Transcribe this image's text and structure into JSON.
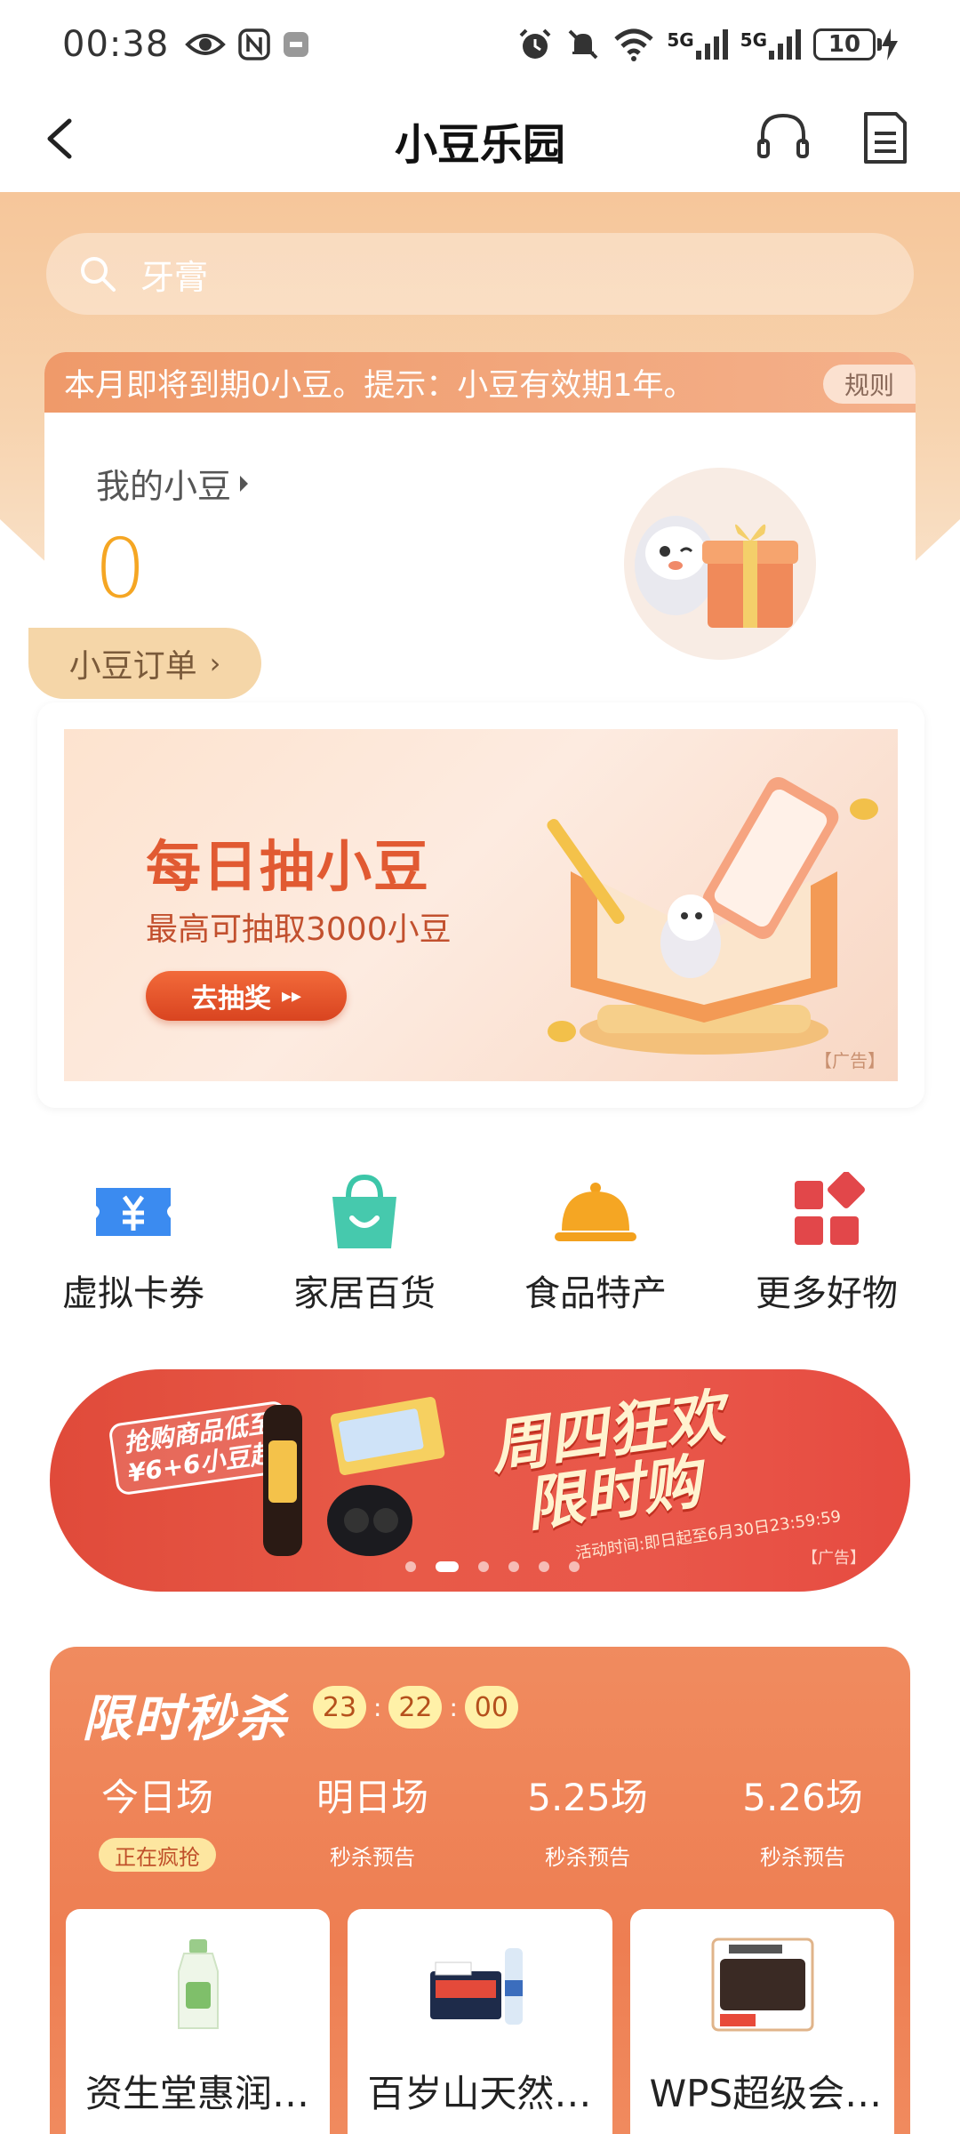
{
  "status_bar": {
    "time": "00:38",
    "battery": "10",
    "network_5g_1": "5G",
    "network_5g_2": "5G"
  },
  "nav": {
    "title": "小豆乐园"
  },
  "search": {
    "placeholder": "牙膏"
  },
  "points": {
    "notice": "本月即将到期0小豆。提示：小豆有效期1年。",
    "rules_label": "规则",
    "my_points_label": "我的小豆",
    "value": "0",
    "orders_label": "小豆订单"
  },
  "lottery": {
    "title": "每日抽小豆",
    "subtitle": "最高可抽取3000小豆",
    "button": "去抽奖",
    "ad_label": "【广告】"
  },
  "categories": [
    {
      "label": "虚拟卡券",
      "icon": "coupon-icon"
    },
    {
      "label": "家居百货",
      "icon": "shopping-bag-icon"
    },
    {
      "label": "食品特产",
      "icon": "food-cloche-icon"
    },
    {
      "label": "更多好物",
      "icon": "more-grid-icon"
    }
  ],
  "promo": {
    "tag": "抢购商品低至 ¥6+6小豆起",
    "title_line1": "周四狂欢",
    "title_line2": "限时购",
    "subtitle": "活动时间:即日起至6月30日23:59:59",
    "ad_label": "【广告】",
    "slides": 6,
    "active_slide": 1
  },
  "flash_sale": {
    "title": "限时秒杀",
    "timer": {
      "h": "23",
      "m": "22",
      "s": "00"
    },
    "sessions": [
      {
        "name": "今日场",
        "status": "正在疯抢",
        "active": true
      },
      {
        "name": "明日场",
        "status": "秒杀预告",
        "active": false
      },
      {
        "name": "5.25场",
        "status": "秒杀预告",
        "active": false
      },
      {
        "name": "5.26场",
        "status": "秒杀预告",
        "active": false
      }
    ],
    "products": [
      {
        "name": "资生堂惠润…"
      },
      {
        "name": "百岁山天然…"
      },
      {
        "name": "WPS超级会…"
      }
    ]
  },
  "colors": {
    "accent_orange": "#f5a623",
    "flash_bg": "#ee7e52",
    "promo_red": "#e04a3a"
  }
}
